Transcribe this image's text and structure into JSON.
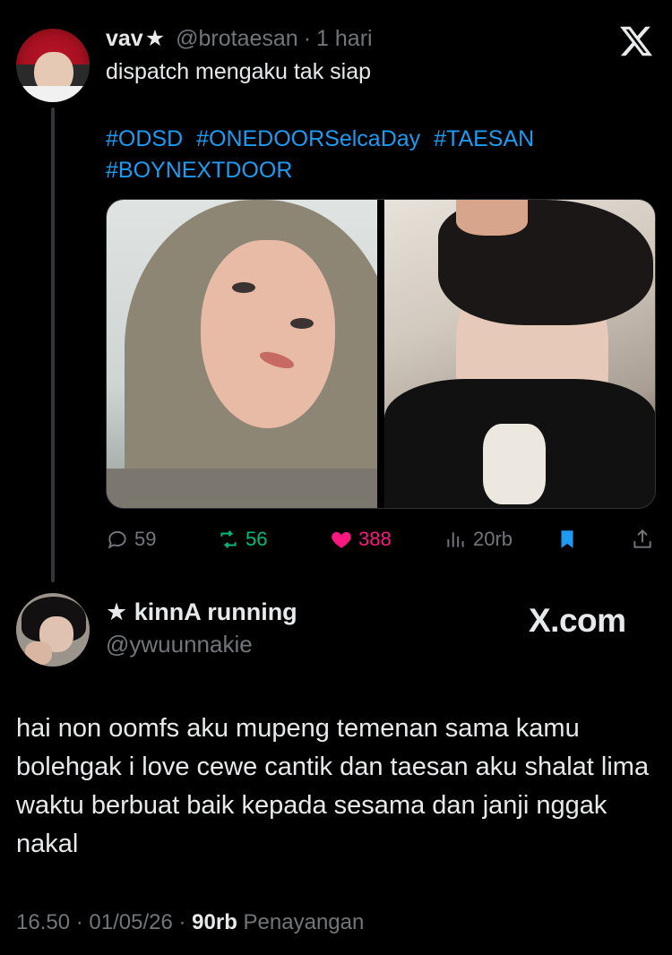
{
  "quoted_tweet": {
    "author_name": "vav",
    "author_star": "★",
    "handle": "@brotaesan",
    "separator": "·",
    "time": "1 hari",
    "text": "dispatch mengaku tak siap",
    "hashtags": [
      "#ODSD",
      "#ONEDOORSelcaDay",
      "#TAESAN",
      "#BOYNEXTDOOR"
    ],
    "stats": {
      "replies": "59",
      "retweets": "56",
      "likes": "388",
      "views": "20rb"
    },
    "colors": {
      "hashtag": "#1d9bf0",
      "retweet": "#00ba7c",
      "like": "#f91880",
      "bookmark": "#1d9bf0"
    }
  },
  "reply": {
    "display_name": "★ kinnA running",
    "handle": "@ywuunnakie",
    "brand": "X.com",
    "body": "hai non oomfs aku mupeng temenan sama kamu bolehgak i love cewe cantik dan taesan aku shalat lima waktu berbuat baik kepada sesama dan janji nggak nakal",
    "time": "16.50",
    "date": "01/05/26",
    "views": "90rb",
    "views_label": "Penayangan",
    "separator": "·"
  }
}
